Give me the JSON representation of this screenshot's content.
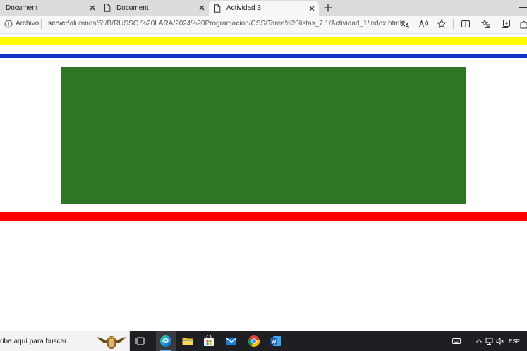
{
  "browser": {
    "tabs": [
      {
        "title": "Document",
        "active": false
      },
      {
        "title": "Document",
        "active": false
      },
      {
        "title": "Actividad 3",
        "active": true
      }
    ],
    "address_bar": {
      "security_label": "Archivo",
      "url_host": "server",
      "url_path": "/alumnos/5°/B/RUSSO.%20LARA/2024%20Programacion/CSS/Tarea%20listas_7.1/Actividad_1/index.html"
    }
  },
  "page": {
    "stripes": [
      {
        "name": "yellow",
        "color": "#ffff00"
      },
      {
        "name": "blue",
        "color": "#0a35c8"
      },
      {
        "name": "red",
        "color": "#ff0000"
      }
    ],
    "box_color": "#2e7524"
  },
  "taskbar": {
    "search_placeholder": "ribe aquí para buscar.",
    "apps": [
      "task-view",
      "edge",
      "file-explorer",
      "store",
      "mail",
      "chrome",
      "word"
    ],
    "language": "ESP"
  }
}
